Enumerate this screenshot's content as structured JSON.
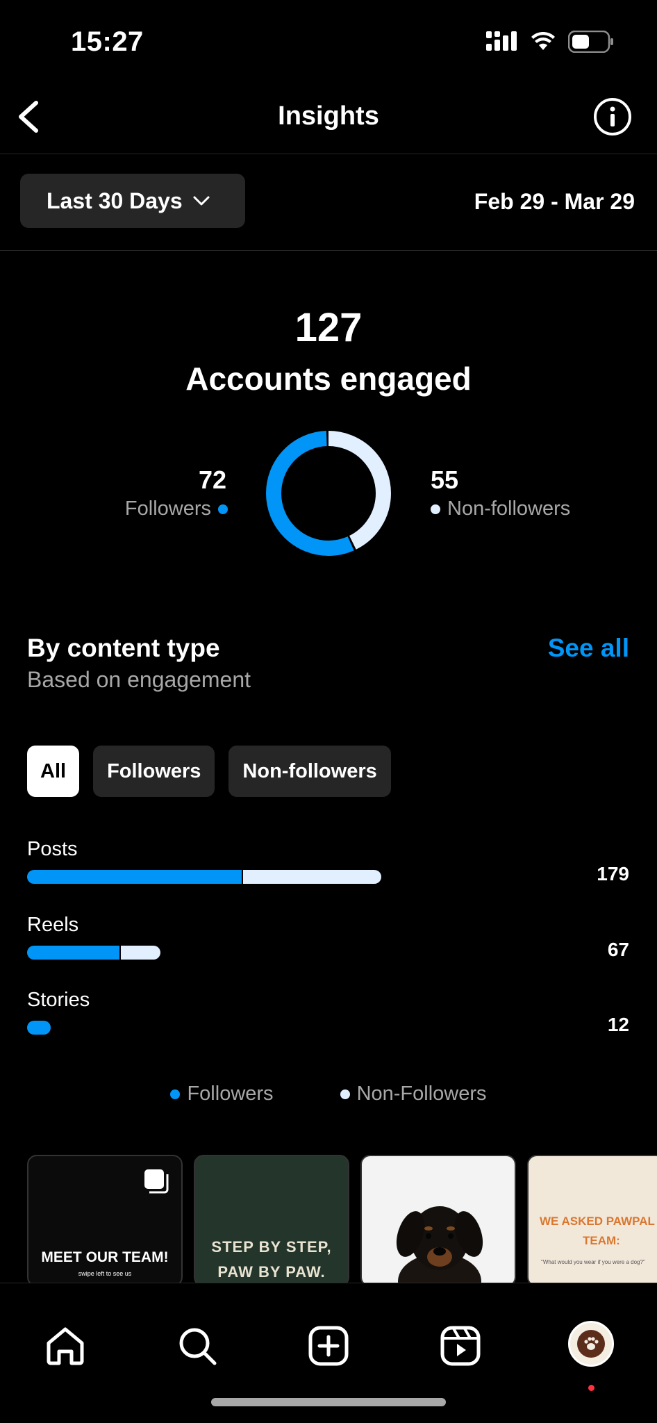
{
  "status_bar": {
    "time": "15:27"
  },
  "header": {
    "title": "Insights"
  },
  "date_range": {
    "selector_label": "Last 30 Days",
    "dates": "Feb 29 - Mar 29"
  },
  "engaged": {
    "total": "127",
    "label": "Accounts engaged",
    "followers_value": "72",
    "followers_label": "Followers",
    "non_followers_value": "55",
    "non_followers_label": "Non-followers"
  },
  "content_type": {
    "title": "By content type",
    "subtitle": "Based on engagement",
    "see_all": "See all",
    "filters": [
      "All",
      "Followers",
      "Non-followers"
    ],
    "active_filter": "All",
    "rows": [
      {
        "label": "Posts",
        "value": "179"
      },
      {
        "label": "Reels",
        "value": "67"
      },
      {
        "label": "Stories",
        "value": "12"
      }
    ],
    "legend": {
      "followers": "Followers",
      "non_followers": "Non-Followers"
    }
  },
  "chart_data": {
    "type": "bar",
    "categories": [
      "Posts",
      "Reels",
      "Stories"
    ],
    "series": [
      {
        "name": "Followers",
        "values": [
          109,
          47,
          12
        ]
      },
      {
        "name": "Non-Followers",
        "values": [
          70,
          20,
          0
        ]
      }
    ],
    "totals": [
      179,
      67,
      12
    ],
    "donut": {
      "followers": 72,
      "non_followers": 55
    }
  },
  "thumbnails": [
    {
      "title": "MEET OUR TEAM!",
      "caption": "swipe left to see us"
    },
    {
      "title_line1": "STEP BY STEP,",
      "title_line2": "PAW BY PAW."
    },
    {
      "title": ""
    },
    {
      "title_line1": "WE ASKED PAWPAL",
      "title_line2": "TEAM:",
      "caption": "\"What would you wear if you were a dog?\""
    }
  ],
  "colors": {
    "followers": "#0095f6",
    "non_followers": "#e1efff",
    "accent": "#0095f6"
  },
  "nav": {
    "icons": [
      "home-icon",
      "search-icon",
      "create-icon",
      "reels-icon",
      "profile-avatar"
    ]
  }
}
